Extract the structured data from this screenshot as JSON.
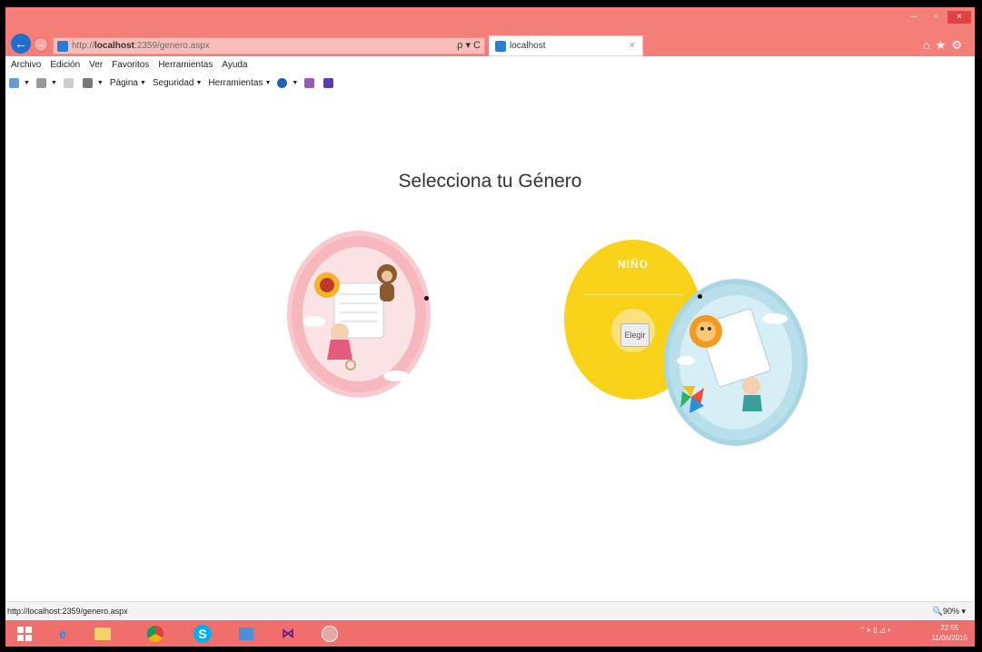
{
  "browser": {
    "back": "←",
    "forward": "→",
    "url_prefix": "http://",
    "url_host": "localhost",
    "url_rest": ":2359/genero.aspx",
    "address_tools": "ρ ▾ C",
    "tab_title": "localhost",
    "tab_close": "×",
    "window_controls": [
      "–",
      "▫",
      "×"
    ],
    "right_icons": "⌂★⚙"
  },
  "menu": [
    "Archivo",
    "Edición",
    "Ver",
    "Favoritos",
    "Herramientas",
    "Ayuda"
  ],
  "commandbar": [
    {
      "label": "",
      "icon": "home-icon"
    },
    {
      "label": "",
      "icon": "feeds-icon"
    },
    {
      "label": "",
      "icon": "mail-icon"
    },
    {
      "label": "",
      "icon": "print-icon"
    },
    {
      "label": "Página",
      "icon": ""
    },
    {
      "label": "Seguridad",
      "icon": ""
    },
    {
      "label": "Herramientas",
      "icon": ""
    },
    {
      "label": "",
      "icon": "help-icon"
    }
  ],
  "page": {
    "title": "Selecciona tu Género",
    "boy_title": "NIÑO",
    "choose_label": "Elegir"
  },
  "status": {
    "url": "http://localhost:2359/genero.aspx",
    "zoom": "🔍90%  ▾"
  },
  "taskbar": {
    "clock_time": "22:55",
    "clock_date": "11/06/2015",
    "tray": "⌃ ▸ ▯ ◿ ◖"
  },
  "colors": {
    "titlebar": "#f47f78",
    "boy_card": "#f8d219",
    "girl_card": "#f8c9ce",
    "boy_art": "#a9d6e4"
  }
}
